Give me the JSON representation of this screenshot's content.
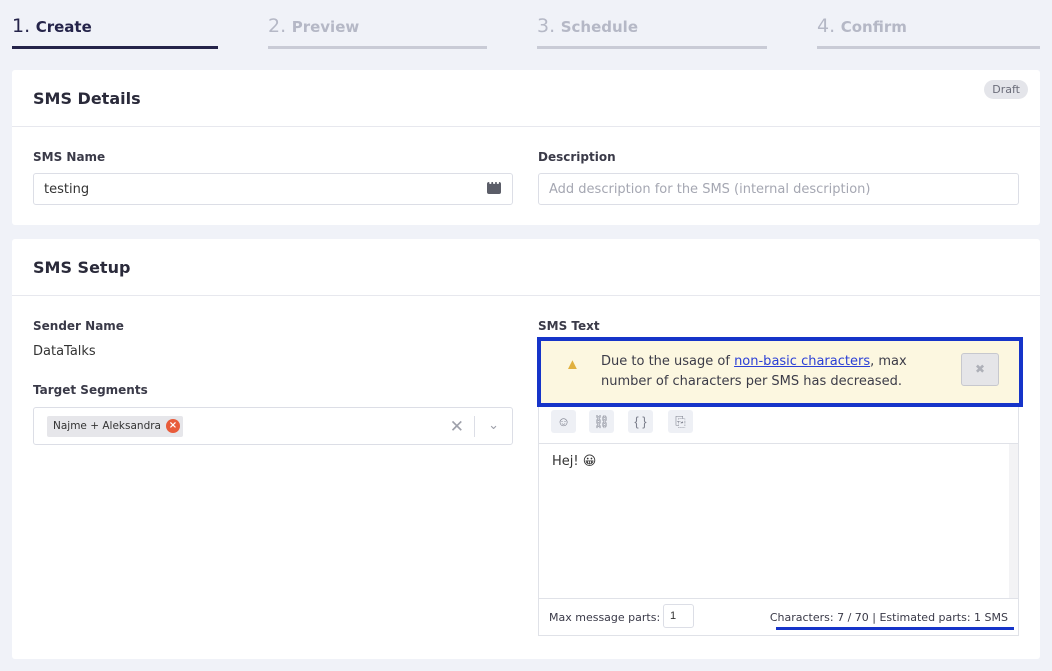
{
  "stepper": [
    {
      "num": "1.",
      "label": "Create"
    },
    {
      "num": "2.",
      "label": "Preview"
    },
    {
      "num": "3.",
      "label": "Schedule"
    },
    {
      "num": "4.",
      "label": "Confirm"
    }
  ],
  "details": {
    "title": "SMS Details",
    "badge": "Draft",
    "name_label": "SMS Name",
    "name_value": "testing",
    "desc_label": "Description",
    "desc_placeholder": "Add description for the SMS (internal description)"
  },
  "setup": {
    "title": "SMS Setup",
    "sender_label": "Sender Name",
    "sender_value": "DataTalks",
    "segments_label": "Target Segments",
    "segment_chip": "Najme + Aleksandra",
    "sms_text_label": "SMS Text",
    "warning_prefix": "Due to the usage of",
    "warning_link": "non-basic characters",
    "warning_suffix": ", max number of characters per SMS has decreased.",
    "editor_text": "Hej! 😀",
    "max_parts_label": "Max message parts:",
    "max_parts_value": "1",
    "chars_text": "Characters: 7 / 70 | Estimated parts: 1 SMS"
  },
  "colors": {
    "accent": "#25244a",
    "highlight": "#1634c9",
    "warning_bg": "#fcf7e0"
  }
}
